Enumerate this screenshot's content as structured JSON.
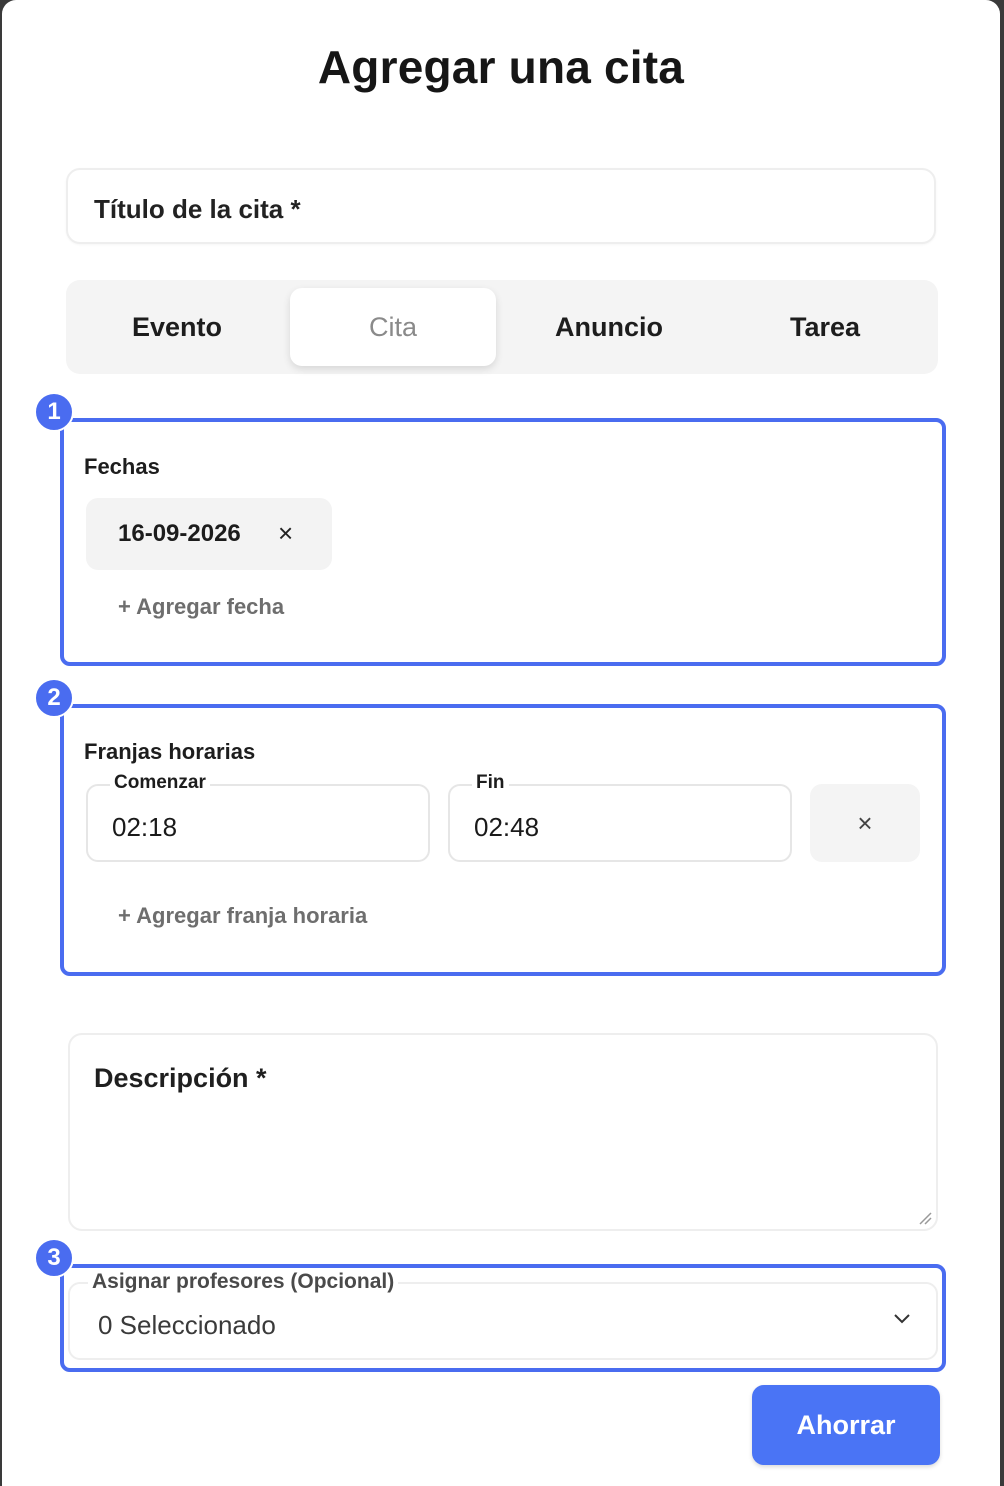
{
  "modal": {
    "title": "Agregar una cita"
  },
  "title_field": {
    "placeholder": "Título de la cita *"
  },
  "tabs": [
    {
      "label": "Evento",
      "active": false
    },
    {
      "label": "Cita",
      "active": true
    },
    {
      "label": "Anuncio",
      "active": false
    },
    {
      "label": "Tarea",
      "active": false
    }
  ],
  "annotations": [
    "1",
    "2",
    "3"
  ],
  "dates": {
    "label": "Fechas",
    "items": [
      {
        "value": "16-09-2026",
        "remove": "×"
      }
    ],
    "add_label": "+ Agregar fecha"
  },
  "time_slots": {
    "label": "Franjas horarias",
    "start_label": "Comenzar",
    "start_value": "02:18",
    "end_label": "Fin",
    "end_value": "02:48",
    "remove": "×",
    "add_label": "+ Agregar franja horaria"
  },
  "description": {
    "placeholder": "Descripción *"
  },
  "teachers": {
    "label": "Asignar profesores (Opcional)",
    "value": "0 Seleccionado"
  },
  "save_button": {
    "label": "Ahorrar"
  },
  "colors": {
    "accent": "#4a6cf0",
    "button": "#4a74f5"
  }
}
